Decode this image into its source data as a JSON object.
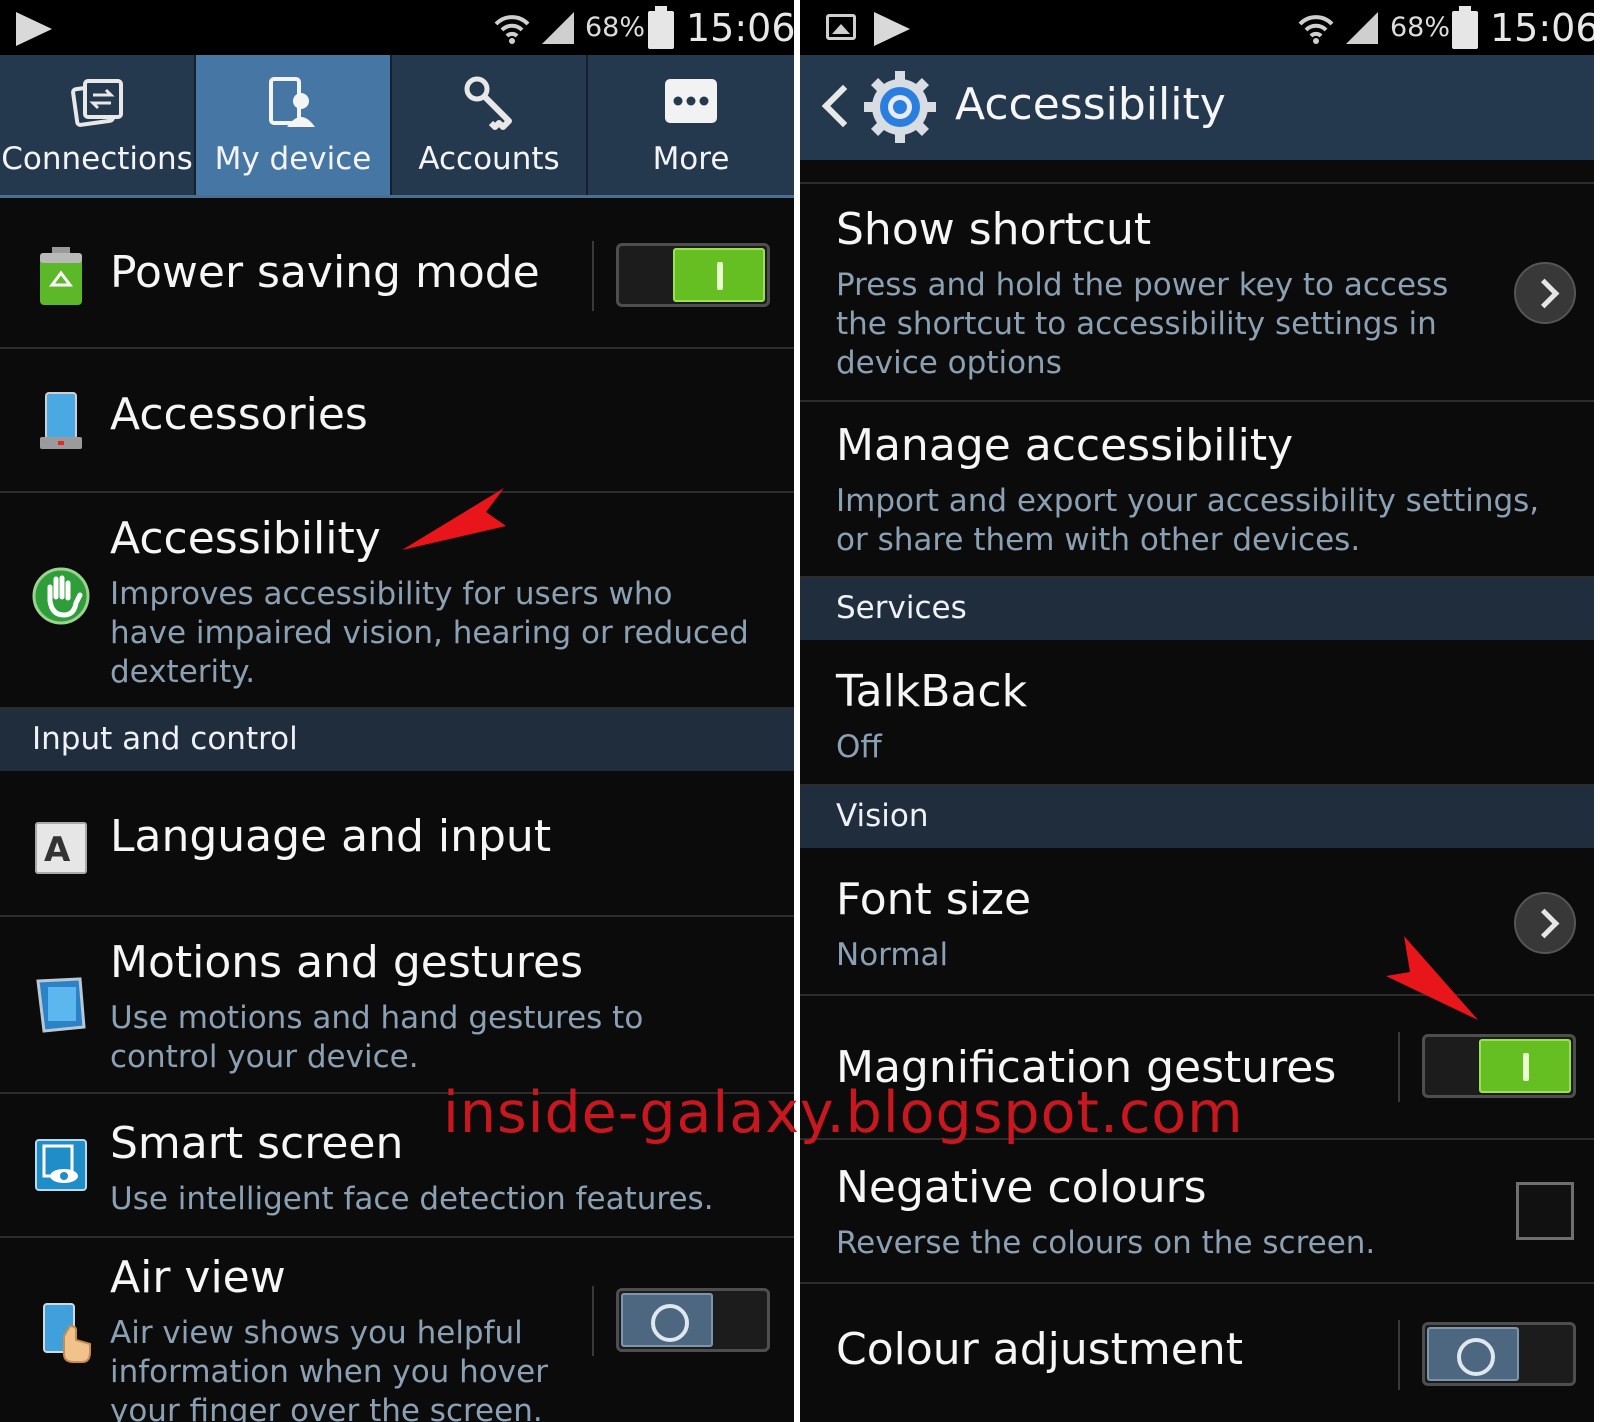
{
  "status_bar": {
    "battery_percent": "68%",
    "time": "15:06"
  },
  "left": {
    "tabs": [
      {
        "label": "Connections",
        "icon": "connections-icon",
        "active": false
      },
      {
        "label": "My device",
        "icon": "my-device-icon",
        "active": true
      },
      {
        "label": "Accounts",
        "icon": "accounts-icon",
        "active": false
      },
      {
        "label": "More",
        "icon": "more-icon",
        "active": false
      }
    ],
    "power_saving": {
      "title": "Power saving mode",
      "toggle": "on"
    },
    "accessories": {
      "title": "Accessories"
    },
    "accessibility": {
      "title": "Accessibility",
      "subtitle": "Improves accessibility for users who have impaired vision, hearing or reduced dexterity."
    },
    "section_input": "Input and control",
    "language": {
      "title": "Language and input"
    },
    "motions": {
      "title": "Motions and gestures",
      "subtitle": "Use motions and hand gestures to control your device."
    },
    "smart_screen": {
      "title": "Smart screen",
      "subtitle": "Use intelligent face detection features."
    },
    "air_view": {
      "title": "Air view",
      "subtitle": "Air view shows you helpful information when you hover your finger over the screen.",
      "toggle": "off"
    }
  },
  "right": {
    "header_title": "Accessibility",
    "show_shortcut": {
      "title": "Show shortcut",
      "subtitle": "Press and hold the power key to access the shortcut to accessibility settings in device options"
    },
    "manage": {
      "title": "Manage accessibility",
      "subtitle": "Import and export your accessibility settings, or share them with other devices."
    },
    "section_services": "Services",
    "talkback": {
      "title": "TalkBack",
      "value": "Off"
    },
    "section_vision": "Vision",
    "font_size": {
      "title": "Font size",
      "value": "Normal"
    },
    "magnification": {
      "title": "Magnification gestures",
      "toggle": "on"
    },
    "negative": {
      "title": "Negative colours",
      "subtitle": "Reverse the colours on the screen.",
      "checked": false
    },
    "colour_adjust": {
      "title": "Colour adjustment",
      "toggle": "off"
    }
  },
  "watermark": "inside-galaxy.blogspot.com",
  "colors": {
    "tab_bar": "#24384e",
    "tab_active": "#4676a4",
    "toggle_on": "#66bf22",
    "toggle_off": "#4d6781",
    "subtitle": "#8ba0b3",
    "arrow": "#e8151b"
  }
}
